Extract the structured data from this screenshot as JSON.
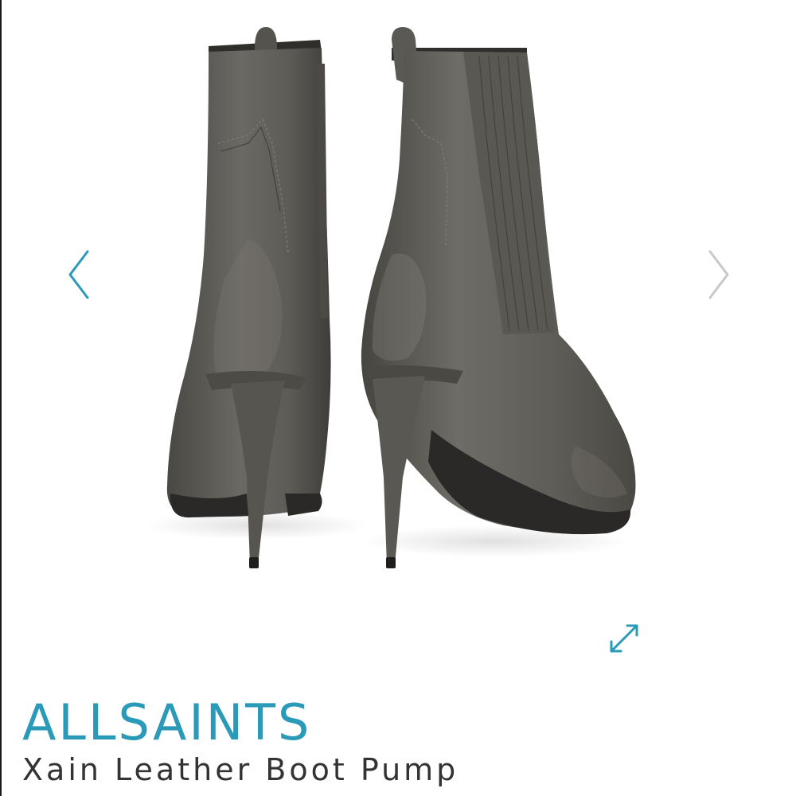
{
  "colors": {
    "accent": "#2a9ab8",
    "arrow_inactive": "#c8c8c8",
    "text": "#333333",
    "leather": "#5c5a55"
  },
  "gallery": {
    "image_alt": "Xain Leather Boot Pump — rear view, grey leather stiletto ankle boots",
    "prev_icon": "chevron-left-icon",
    "next_icon": "chevron-right-icon",
    "expand_icon": "expand-arrows-icon"
  },
  "product": {
    "brand": "ALLSAINTS",
    "name": "Xain Leather Boot Pump"
  }
}
